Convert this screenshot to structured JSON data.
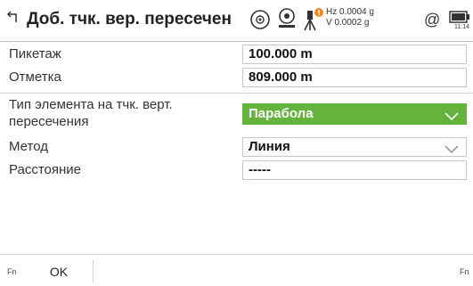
{
  "header": {
    "title": "Доб. тчк. вер. пересечен",
    "back_icon": "back-arrow-icon",
    "hz": "Hz 0.0004 g",
    "v": "V  0.0002 g",
    "time": "11:14",
    "icons": [
      "target-prism-icon",
      "level-icon",
      "instrument-warning-icon",
      "at-mode-icon",
      "battery-icon"
    ],
    "warning_color": "#f08a1c"
  },
  "fields": [
    {
      "label": "Пикетаж",
      "value": "100.000 m"
    },
    {
      "label": "Отметка",
      "value": "809.000 m"
    }
  ],
  "element_type": {
    "label_line1": "Тип элемента на тчк. верт.",
    "label_line2": "пересечения",
    "value": "Парабола",
    "color": "#64b33d"
  },
  "method": {
    "label": "Метод",
    "value": "Линия"
  },
  "distance": {
    "label": "Расстояние",
    "value": "-----"
  },
  "softkeys": {
    "fn_left": "Fn",
    "ok": "OK",
    "fn_right": "Fn"
  }
}
